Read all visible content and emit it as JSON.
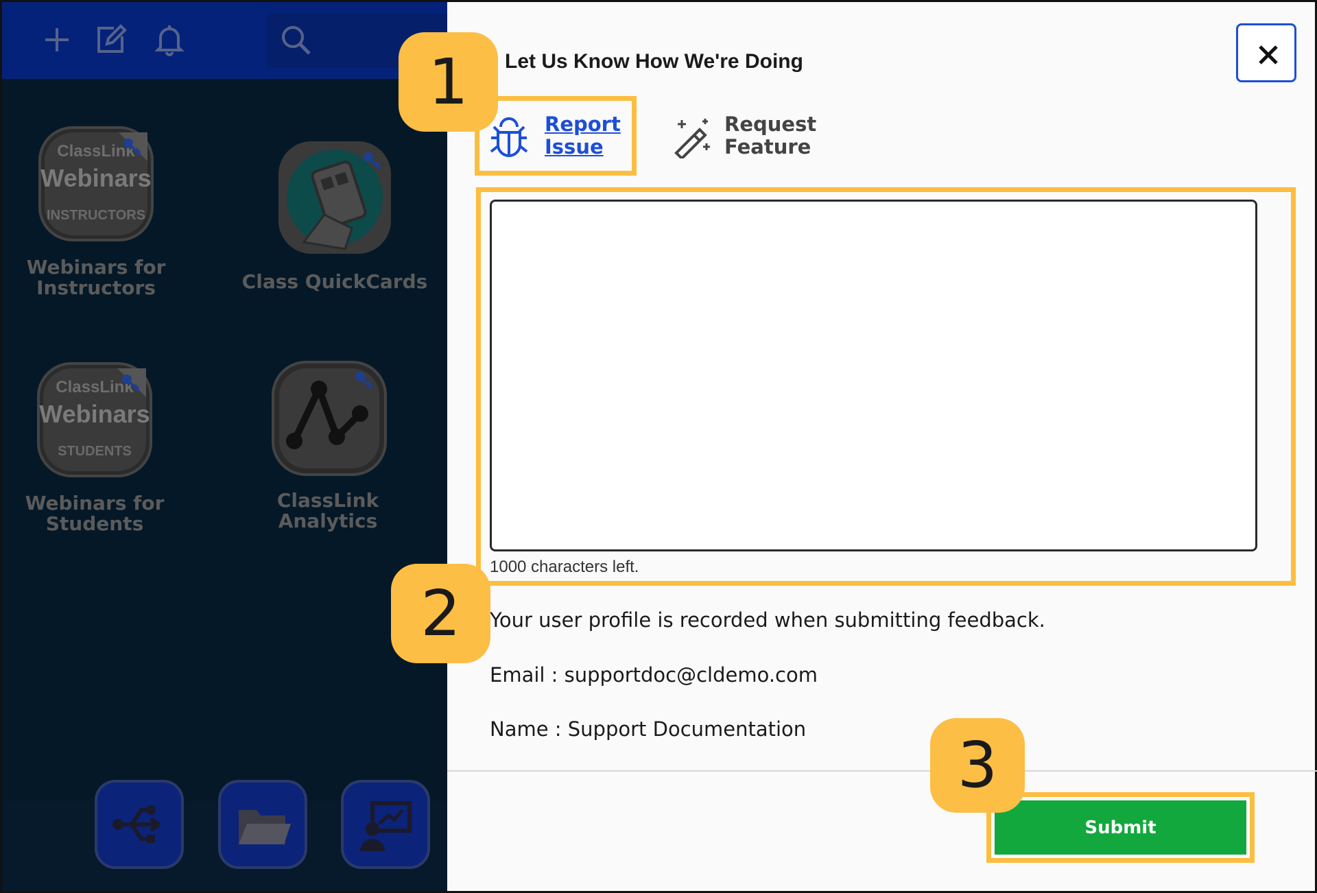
{
  "topbar": {
    "icons": [
      "plus-icon",
      "edit-icon",
      "bell-icon",
      "search-icon"
    ]
  },
  "apps": [
    {
      "label": "Webinars for Instructors",
      "badge_line1": "ClassLink",
      "badge_line2": "Webinars",
      "badge_line3": "INSTRUCTORS"
    },
    {
      "label": "Class QuickCards"
    },
    {
      "label": "Webinars for Students",
      "badge_line1": "ClassLink",
      "badge_line2": "Webinars",
      "badge_line3": "STUDENTS"
    },
    {
      "label": "ClassLink Analytics"
    }
  ],
  "dock": {
    "icons": [
      "share-usb-icon",
      "folder-icon",
      "presentation-user-icon"
    ]
  },
  "dialog": {
    "title": "Let Us Know How We're Doing",
    "close_icon": "close-icon",
    "tabs": [
      {
        "label_line1": "Report",
        "label_line2": "Issue",
        "icon": "bug-icon",
        "selected": true
      },
      {
        "label_line1": "Request",
        "label_line2": "Feature",
        "icon": "magic-wand-icon",
        "selected": false
      }
    ],
    "feedback": {
      "value": "",
      "placeholder": ""
    },
    "char_count": "1000 characters left.",
    "profile_notice": "Your user profile is recorded when submitting feedback.",
    "email_line": "Email : supportdoc@cldemo.com",
    "name_line": "Name : Support Documentation",
    "submit_label": "Submit"
  },
  "steps": [
    "1",
    "2",
    "3"
  ],
  "colors": {
    "highlight": "#fcbd40",
    "link": "#1d4fd6",
    "submit": "#12a83d",
    "topbar": "#05227a"
  }
}
